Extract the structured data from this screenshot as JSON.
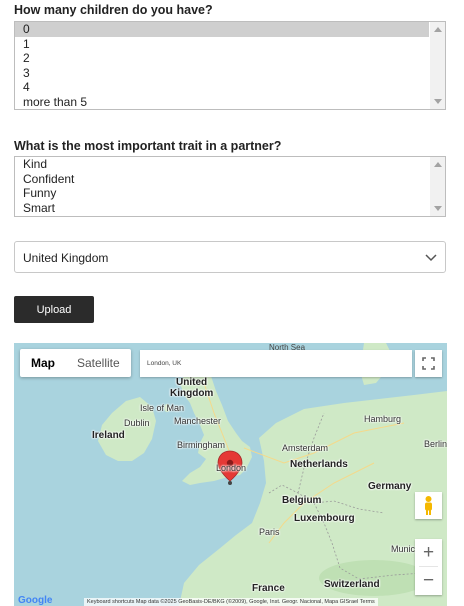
{
  "children": {
    "question": "How many children do you have?",
    "options": [
      "0",
      "1",
      "2",
      "3",
      "4",
      "more than 5"
    ],
    "selected": "0"
  },
  "trait": {
    "question": "What is the most important trait in a partner?",
    "options": [
      "Kind",
      "Confident",
      "Funny",
      "Smart"
    ]
  },
  "country": {
    "value": "United Kingdom"
  },
  "upload": {
    "label": "Upload"
  },
  "map": {
    "type_map": "Map",
    "type_satellite": "Satellite",
    "search_text": "London, UK",
    "labels": {
      "north_sea": "North Sea",
      "united": "United",
      "kingdom": "Kingdom",
      "isle_of_man": "Isle of Man",
      "manchester": "Manchester",
      "ireland": "Ireland",
      "dublin": "Dublin",
      "birmingham": "Birmingham",
      "london": "London",
      "amsterdam": "Amsterdam",
      "netherlands": "Netherlands",
      "hamburg": "Hamburg",
      "berlin": "Berlin",
      "germany": "Germany",
      "belgium": "Belgium",
      "luxembourg": "Luxembourg",
      "paris": "Paris",
      "munich": "Munic",
      "france": "France",
      "switzerland": "Switzerland"
    },
    "attribution": "Keyboard shortcuts    Map data ©2025 GeoBasis-DE/BKG (©2009), Google, Inst. Geogr. Nacional, Mapa GISrael    Terms",
    "google": "Google",
    "zoom_in": "+",
    "zoom_out": "−"
  }
}
